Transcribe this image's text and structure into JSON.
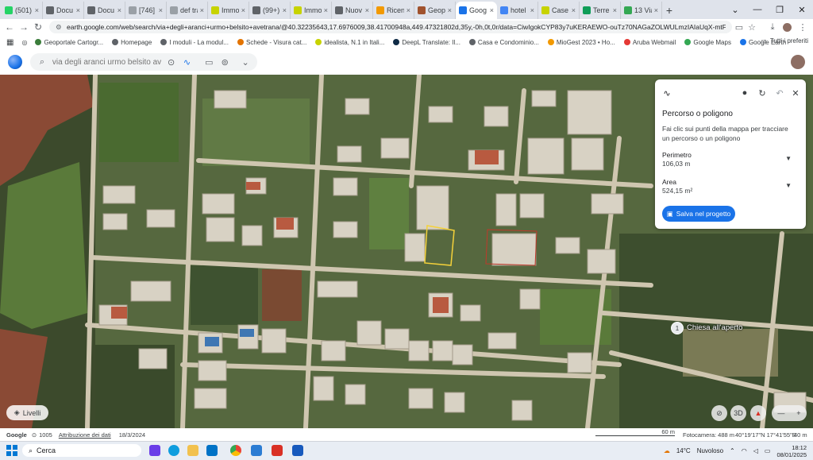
{
  "browser": {
    "tabs": [
      {
        "label": "(501)",
        "icon": "whatsapp-icon",
        "color": "#25d366"
      },
      {
        "label": "Docu",
        "icon": "doc-icon",
        "color": "#5f6368"
      },
      {
        "label": "Docu",
        "icon": "doc-icon",
        "color": "#5f6368"
      },
      {
        "label": "[746]",
        "icon": "page-icon",
        "color": "#9aa0a6"
      },
      {
        "label": "def tra",
        "icon": "page-icon",
        "color": "#9aa0a6"
      },
      {
        "label": "Immo",
        "icon": "idealista-icon",
        "color": "#c7d300"
      },
      {
        "label": "(99+)",
        "icon": "page-icon",
        "color": "#5f6368"
      },
      {
        "label": "Immo",
        "icon": "idealista-icon",
        "color": "#c7d300"
      },
      {
        "label": "Nuov",
        "icon": "page-icon",
        "color": "#5f6368"
      },
      {
        "label": "Ricen",
        "icon": "page-icon",
        "color": "#f29900"
      },
      {
        "label": "Geop",
        "icon": "page-icon",
        "color": "#a0522d"
      },
      {
        "label": "Goog",
        "icon": "earth-icon",
        "color": "#1a73e8",
        "active": true
      },
      {
        "label": "hotel",
        "icon": "google-icon",
        "color": "#4285f4"
      },
      {
        "label": "Case",
        "icon": "idealista-icon",
        "color": "#c7d300"
      },
      {
        "label": "Terre",
        "icon": "page-icon",
        "color": "#0f9d58"
      },
      {
        "label": "13 Via",
        "icon": "maps-icon",
        "color": "#34a853"
      }
    ],
    "new_tab": "+",
    "url": "earth.google.com/web/search/via+degli+aranci+urmo+belsito+avetrana/@40.32235643,17.6976009,38.41700948a,449.47321802d,35y,-0h,0t,0r/data=CiwIgokCYP83y7uKERAEWO-ouTz70NAGaZOLWULmzIAIaUqX-mtFjIAQgIlATo0CgEwQgIlAEoNCP___..."
  },
  "bookmarks": [
    {
      "label": "Geoportale Cartogr...",
      "color": "#3b7d3b"
    },
    {
      "label": "Homepage",
      "color": "#5f6368"
    },
    {
      "label": "I moduli - La modul...",
      "color": "#5f6368"
    },
    {
      "label": "Schede - Visura cat...",
      "color": "#e37400"
    },
    {
      "label": "idealista, N.1 in Itali...",
      "color": "#c7d300"
    },
    {
      "label": "DeepL Translate: Il...",
      "color": "#0f2b46"
    },
    {
      "label": "Casa e Condominio...",
      "color": "#5f6368"
    },
    {
      "label": "MioGest 2023 • Ho...",
      "color": "#f29900"
    },
    {
      "label": "Aruba Webmail",
      "color": "#e53935"
    },
    {
      "label": "Google Maps",
      "color": "#34a853"
    },
    {
      "label": "Google Earth",
      "color": "#1a73e8"
    }
  ],
  "bookmarks_all": "Tutti i preferiti",
  "earth": {
    "search_placeholder": "via degli aranci urmo belsito avetr"
  },
  "panel": {
    "title": "Percorso o poligono",
    "description": "Fai clic sui punti della mappa per tracciare un percorso o un poligono",
    "perimeter_label": "Perimetro",
    "perimeter_value": "106,03 m",
    "area_label": "Area",
    "area_value": "524,15 m²",
    "save_label": "Salva nel progetto"
  },
  "map": {
    "layers_label": "Livelli",
    "place_label": "Chiesa all'aperto",
    "place_number": "1",
    "view_3d": "3D"
  },
  "status": {
    "google": "Google",
    "year": "1005",
    "attribution": "Attribuzione dei dati",
    "date": "18/3/2024",
    "scale": "60 m",
    "camera": "Fotocamera: 488 m",
    "coords": "40°19'17\"N 17°41'55\"E",
    "altitude": "40 m"
  },
  "taskbar": {
    "search_label": "Cerca",
    "temperature": "14°C",
    "weather": "Nuvoloso",
    "time": "18:12",
    "date": "08/01/2025"
  },
  "colors": {
    "accent": "#1a73e8",
    "polygon": "#f4d13a"
  }
}
